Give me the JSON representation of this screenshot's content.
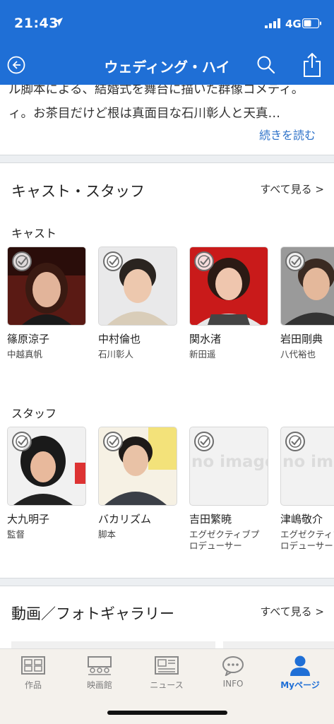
{
  "status": {
    "time": "21:43",
    "network": "4G"
  },
  "nav": {
    "title": "ウェディング・ハイ"
  },
  "synopsis": {
    "line1": "ル脚本による、結婚式を舞台に描いた群像コメディ。",
    "line2": "ィ。お茶目だけど根は真面目な石川彰人と天真…",
    "read_more": "続きを読む"
  },
  "cast_staff": {
    "title": "キャスト・スタッフ",
    "see_all": "すべて見る >",
    "cast_label": "キャスト",
    "cast": [
      {
        "name": "篠原涼子",
        "role": "中越真帆"
      },
      {
        "name": "中村倫也",
        "role": "石川彰人"
      },
      {
        "name": "関水渚",
        "role": "新田遥"
      },
      {
        "name": "岩田剛典",
        "role": "八代裕也"
      }
    ],
    "staff_label": "スタッフ",
    "staff": [
      {
        "name": "大九明子",
        "role": "監督"
      },
      {
        "name": "バカリズム",
        "role": "脚本"
      },
      {
        "name": "吉田繁暁",
        "role": "エグゼクティブプロデューサー"
      },
      {
        "name": "津嶋敬介",
        "role": "エグゼクティブプロデューサー"
      }
    ],
    "no_image": "no image"
  },
  "gallery": {
    "title": "動画／フォトギャラリー",
    "see_all": "すべて見る >"
  },
  "tabs": [
    {
      "label": "作品",
      "icon": "film-icon"
    },
    {
      "label": "映画館",
      "icon": "theater-icon"
    },
    {
      "label": "ニュース",
      "icon": "news-icon"
    },
    {
      "label": "INFO",
      "icon": "info-icon"
    },
    {
      "label": "Myページ",
      "icon": "person-icon",
      "active": true
    }
  ],
  "colors": {
    "brand": "#1f6fd6",
    "link": "#2f73c9"
  }
}
